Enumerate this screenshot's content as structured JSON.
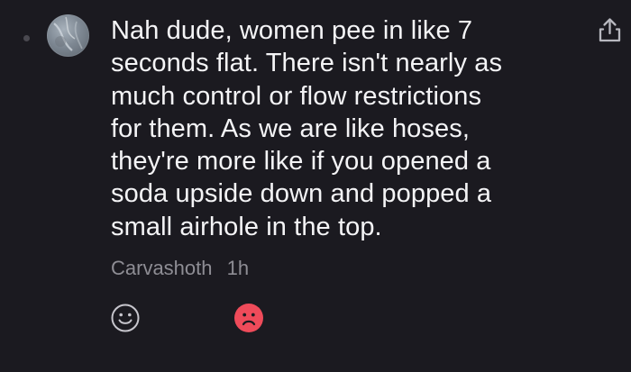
{
  "comment": {
    "text_lines": [
      "Nah dude, women pee in like 7",
      "seconds flat. There isn't nearly as",
      "much control or flow restrictions",
      "for them. As we are like hoses,",
      "they're more like if you opened a",
      "soda upside down and popped a",
      "small airhole in the top."
    ],
    "author": "Carvashoth",
    "timestamp": "1h"
  },
  "icons": {
    "avatar": "avatar-image",
    "share": "share-icon",
    "happy_reaction": "smiley-face-icon",
    "sad_reaction": "sad-face-icon"
  },
  "colors": {
    "background": "#1b1a20",
    "text": "#f4f4f6",
    "meta_text": "#8e8d94",
    "sad_reaction_active": "#ef4b5a"
  }
}
